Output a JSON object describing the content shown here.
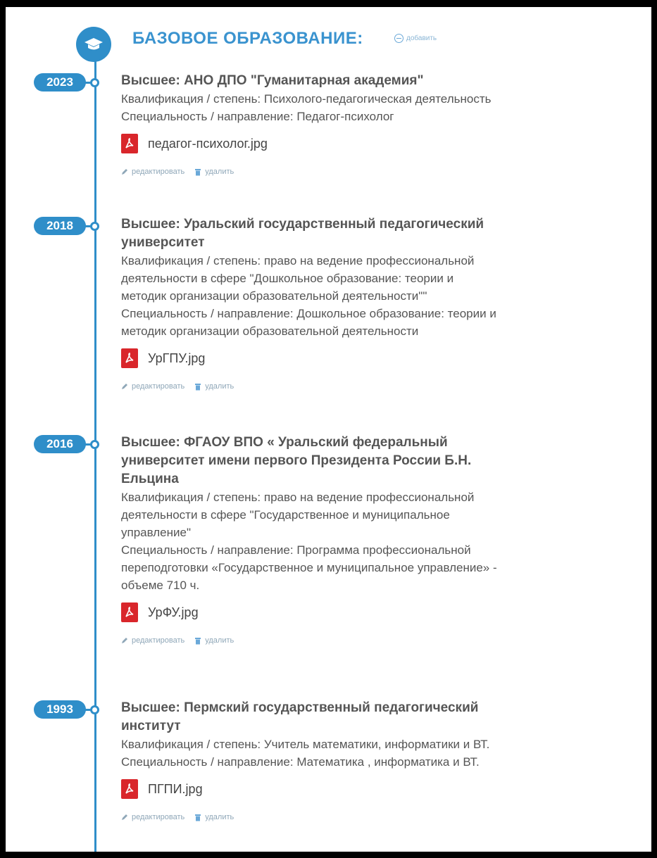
{
  "header": {
    "title": "БАЗОВОЕ ОБРАЗОВАНИЕ:",
    "add_label": "добавить"
  },
  "actions": {
    "edit_label": "редактировать",
    "delete_label": "удалить"
  },
  "colors": {
    "accent": "#2f8ec9",
    "title_blue": "#3a93cf",
    "pdf_red": "#d9262b"
  },
  "entries": [
    {
      "year": "2023",
      "title_lines": [
        "Высшее: АНО ДПО \"Гуманитарная академия\""
      ],
      "text_lines": [
        "Квалификация / степень: Психолого-педагогическая деятельность",
        "Специальность / направление: Педагог-психолог"
      ],
      "file": "педагог-психолог.jpg"
    },
    {
      "year": "2018",
      "title_lines": [
        "Высшее: Уральский государственный педагогический",
        "университет"
      ],
      "text_lines": [
        "Квалификация / степень: право на ведение профессиональной",
        "деятельности в сфере \"Дошкольное образование: теории и",
        "методик организации образовательной деятельности\"\"",
        "Специальность / направление: Дошкольное образование: теории и",
        "методик организации образовательной деятельности"
      ],
      "file": "УрГПУ.jpg"
    },
    {
      "year": "2016",
      "title_lines": [
        "Высшее: ФГАОУ ВПО « Уральский федеральный",
        "университет имени первого Президента России Б.Н.",
        "Ельцина"
      ],
      "text_lines": [
        "Квалификация / степень: право на ведение профессиональной",
        "деятельности в сфере \"Государственное и муниципальное",
        "управление\"",
        "Специальность / направление: Программа профессиональной",
        "переподготовки «Государственное и муниципальное управление» -",
        "объеме 710 ч."
      ],
      "file": "УрФУ.jpg"
    },
    {
      "year": "1993",
      "title_lines": [
        "Высшее: Пермский государственный педагогический",
        "институт"
      ],
      "text_lines": [
        "Квалификация / степень: Учитель математики, информатики и ВТ.",
        "Специальность / направление: Математика , информатика и ВТ."
      ],
      "file": "ПГПИ.jpg"
    }
  ]
}
